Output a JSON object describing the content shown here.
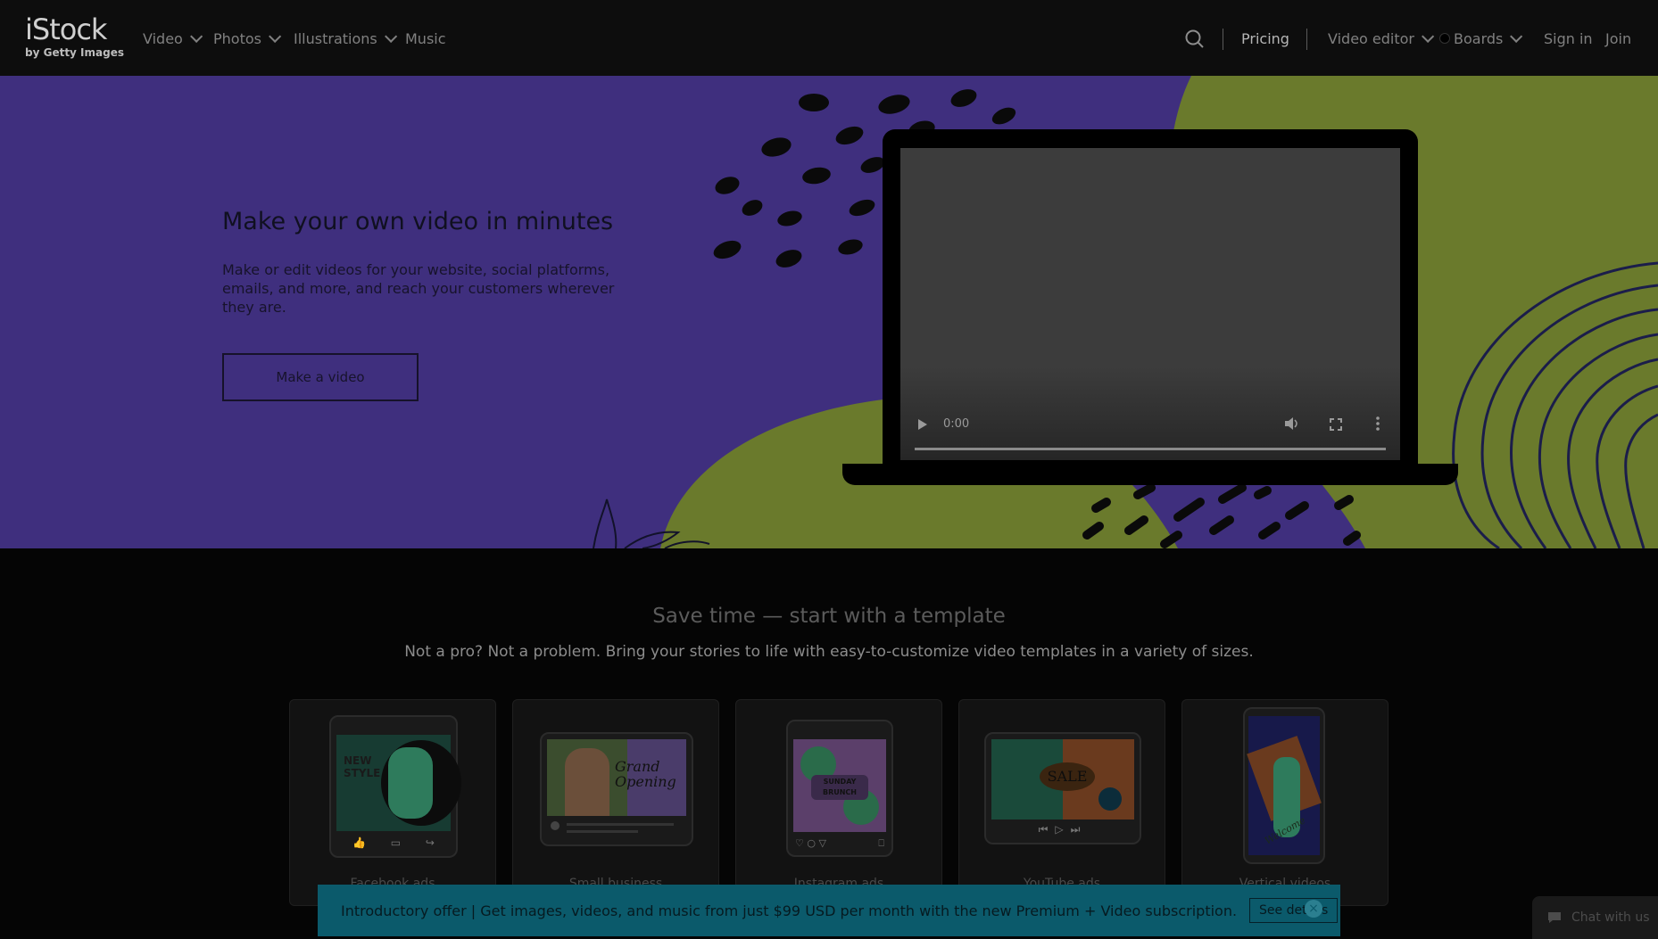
{
  "nav": {
    "logo_main": "iStock",
    "logo_sub": "by Getty Images",
    "items": [
      {
        "label": "Video"
      },
      {
        "label": "Photos"
      },
      {
        "label": "Illustrations"
      },
      {
        "label": "Music"
      }
    ],
    "pricing": "Pricing",
    "video_editor": "Video editor",
    "boards": "Boards",
    "sign_in": "Sign in",
    "join": "Join"
  },
  "hero": {
    "title": "Make your own video in minutes",
    "description": "Make or edit videos for your website, social platforms, emails, and more, and reach your customers wherever they are.",
    "button": "Make a video",
    "video": {
      "time": "0:00"
    }
  },
  "templates": {
    "title": "Save time — start with a template",
    "subtitle": "Not a pro? Not a problem. Bring your stories to life with easy-to-customize video templates in a variety of sizes.",
    "cards": [
      {
        "label": "Facebook ads",
        "thumb_text": "NEW STYLE"
      },
      {
        "label": "Small business",
        "thumb_text": "Grand Opening"
      },
      {
        "label": "Instagram ads",
        "thumb_text": "SUNDAY BRUNCH"
      },
      {
        "label": "YouTube ads",
        "thumb_text": "SALE"
      },
      {
        "label": "Vertical videos",
        "thumb_text": "Welcome"
      }
    ]
  },
  "banner": {
    "text": "Introductory offer | Get images, videos, and music from just $99 USD per month with the new Premium + Video subscription.",
    "button": "See details",
    "close": "×"
  },
  "chat": {
    "label": "Chat with us"
  },
  "colors": {
    "hero_bg": "#3f2f7e",
    "hero_olive": "#6a7a2c",
    "banner": "#0b5a6b"
  }
}
